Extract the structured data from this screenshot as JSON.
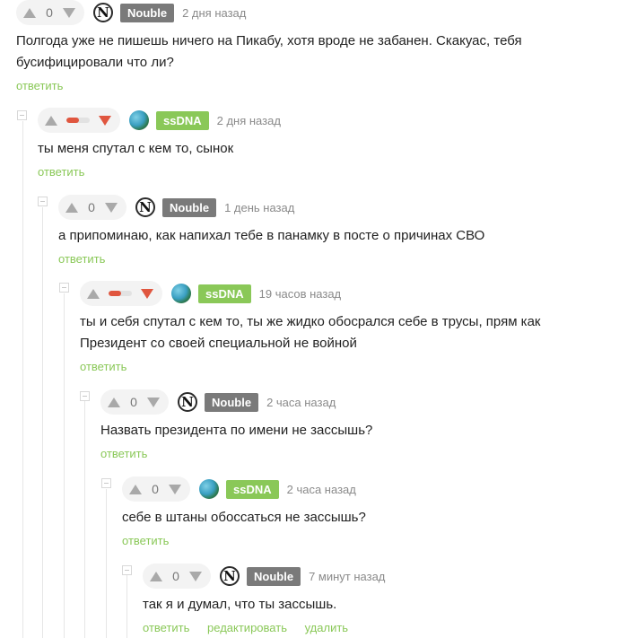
{
  "comments": [
    {
      "vote_score": "0",
      "username": "Nouble",
      "time": "2 дня назад",
      "text": "Полгода уже не пишешь ничего на Пикабу, хотя вроде не забанен. Скакуас, тебя бусифицировали что ли?",
      "reply": "ответить"
    },
    {
      "username": "ssDNA",
      "time": "2 дня назад",
      "text": "ты меня спутал с кем то, сынок",
      "reply": "ответить"
    },
    {
      "vote_score": "0",
      "username": "Nouble",
      "time": "1 день назад",
      "text": "а припоминаю, как напихал тебе в панамку в посте о причинах СВО",
      "reply": "ответить"
    },
    {
      "username": "ssDNA",
      "time": "19 часов назад",
      "text": "ты и себя спутал с кем то, ты же жидко обосрался себе в трусы, прям как Президент со своей специальной не войной",
      "reply": "ответить"
    },
    {
      "vote_score": "0",
      "username": "Nouble",
      "time": "2 часа назад",
      "text": "Назвать президента по имени не зассышь?",
      "reply": "ответить"
    },
    {
      "vote_score": "0",
      "username": "ssDNA",
      "time": "2 часа назад",
      "text": "себе в штаны обоссаться не зассышь?",
      "reply": "ответить"
    },
    {
      "vote_score": "0",
      "username": "Nouble",
      "time": "7 минут назад",
      "text": "так я и думал, что ты зассышь.",
      "reply": "ответить",
      "edit": "редактировать",
      "delete": "удалить"
    }
  ],
  "avatar_letter": "N",
  "colors": {
    "green_tag": "#8ac858",
    "gray_tag": "#7a7a7a",
    "link": "#8ac858",
    "downvote_red": "#e0563f"
  }
}
